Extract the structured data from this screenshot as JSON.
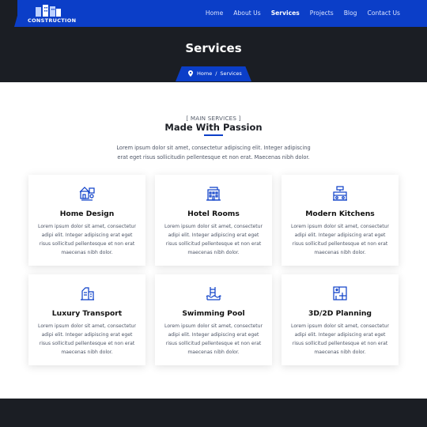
{
  "brand": {
    "name": "CONSTRUCTION",
    "logo_icon": "buildings-icon"
  },
  "nav": {
    "items": [
      {
        "label": "Home",
        "active": false
      },
      {
        "label": "About Us",
        "active": false
      },
      {
        "label": "Services",
        "active": true
      },
      {
        "label": "Projects",
        "active": false
      },
      {
        "label": "Blog",
        "active": false
      },
      {
        "label": "Contact Us",
        "active": false
      }
    ]
  },
  "hero": {
    "title": "Services",
    "breadcrumb": {
      "icon": "map-pin-icon",
      "home": "Home",
      "separator": "/",
      "current": "Services"
    }
  },
  "section": {
    "kicker": "[ MAIN SERVICES ]",
    "title": "Made With Passion",
    "description": "Lorem ipsum dolor sit amet, consectetur adipiscing elit. Integer adipiscing erat eget risus sollicitudin pellentesque et non erat. Maecenas nibh dolor."
  },
  "services": [
    {
      "title": "Home Design",
      "icon": "home-design-icon",
      "text": "Lorem ipsum dolor sit amet, consectetur adipi elit. Integer adipiscing erat eget risus sollicitud pellentesque et non erat maecenas nibh dolor."
    },
    {
      "title": "Hotel Rooms",
      "icon": "hotel-building-icon",
      "text": "Lorem ipsum dolor sit amet, consectetur adipi elit. Integer adipiscing erat eget risus sollicitud pellentesque et non erat maecenas nibh dolor."
    },
    {
      "title": "Modern Kitchens",
      "icon": "kitchen-icon",
      "text": "Lorem ipsum dolor sit amet, consectetur adipi elit. Integer adipiscing erat eget risus sollicitud pellentesque et non erat maecenas nibh dolor."
    },
    {
      "title": "Luxury Transport",
      "icon": "transport-icon",
      "text": "Lorem ipsum dolor sit amet, consectetur adipi elit. Integer adipiscing erat eget risus sollicitud pellentesque et non erat maecenas nibh dolor."
    },
    {
      "title": "Swimming Pool",
      "icon": "swimming-pool-icon",
      "text": "Lorem ipsum dolor sit amet, consectetur adipi elit. Integer adipiscing erat eget risus sollicitud pellentesque et non erat maecenas nibh dolor."
    },
    {
      "title": "3D/2D Planning",
      "icon": "blueprint-icon",
      "text": "Lorem ipsum dolor sit amet, consectetur adipi elit. Integer adipiscing erat eget risus sollicitud pellentesque et non erat maecenas nibh dolor."
    }
  ],
  "colors": {
    "accent": "#0b3ec8",
    "dark": "#1b1e24",
    "text": "#4d5566"
  }
}
